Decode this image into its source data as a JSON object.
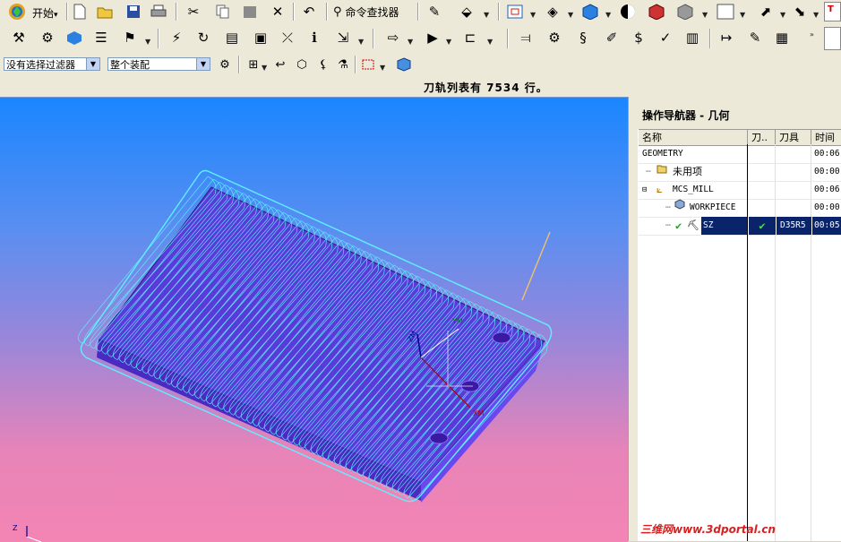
{
  "toolbar": {
    "start_label": "开始",
    "start_dropdown": "▾",
    "command_finder_label": "命令查找器"
  },
  "filterbar": {
    "filter_value": "没有选择过滤器",
    "assembly_value": "整个装配"
  },
  "status": {
    "message": "刀轨列表有 7534 行。"
  },
  "navigator": {
    "title": "操作导航器 - 几何",
    "columns": [
      "名称",
      "刀..",
      "刀具",
      "时间"
    ],
    "rows": [
      {
        "name": "GEOMETRY",
        "check": "",
        "tool": "",
        "time": "00:06"
      },
      {
        "name": "未用项",
        "check": "",
        "tool": "",
        "time": "00:00"
      },
      {
        "name": "MCS_MILL",
        "check": "",
        "tool": "",
        "time": "00:06"
      },
      {
        "name": "WORKPIECE",
        "check": "",
        "tool": "",
        "time": "00:00"
      },
      {
        "name": "SZ",
        "check": "✔",
        "tool": "D35R5",
        "time": "00:05"
      }
    ]
  },
  "viewport": {
    "axis_labels": [
      "ZM",
      "XM",
      "YM"
    ],
    "corner_label": "Z"
  },
  "watermark": {
    "text": "三维网www.3dportal.cn"
  },
  "colors": {
    "toolpath": "#5ef0ff",
    "part": "#7a4ff0",
    "selection": "#0a246a",
    "check_green": "#1aa51a"
  }
}
